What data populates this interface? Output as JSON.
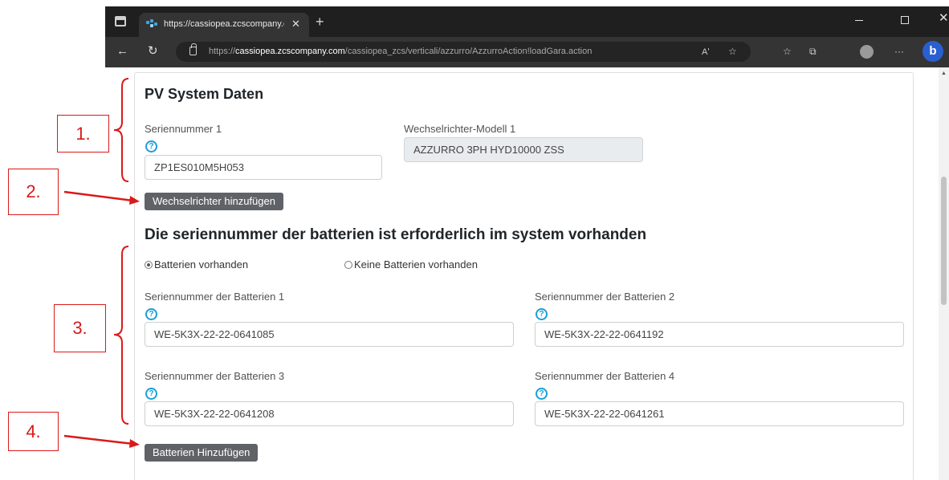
{
  "browser": {
    "tab_title": "https://cassiopea.zcscompany.co",
    "url_prefix": "https://",
    "url_domain": "cassiopea.zcscompany.com",
    "url_path": "/cassiopea_zcs/verticali/azzurro/AzzurroAction!loadGara.action",
    "read_aloud": "Aʹ",
    "more": "···",
    "bing_label": "b"
  },
  "pv": {
    "title": "PV System Daten",
    "serial_label": "Seriennummer 1",
    "serial_value": "ZP1ES010M5H053",
    "model_label": "Wechselrichter-Modell 1",
    "model_value": "AZZURRO 3PH HYD10000 ZSS",
    "add_inverter_label": "Wechselrichter hinzufügen"
  },
  "battery": {
    "title": "Die seriennummer der batterien ist erforderlich im system vorhanden",
    "radio_present": "Batterien vorhanden",
    "radio_absent": "Keine Batterien vorhanden",
    "fields": [
      {
        "label": "Seriennummer der Batterien 1",
        "value": "WE-5K3X-22-22-0641085"
      },
      {
        "label": "Seriennummer der Batterien 2",
        "value": "WE-5K3X-22-22-0641192"
      },
      {
        "label": "Seriennummer der Batterien 3",
        "value": "WE-5K3X-22-22-0641208"
      },
      {
        "label": "Seriennummer der Batterien 4",
        "value": "WE-5K3X-22-22-0641261"
      }
    ],
    "add_battery_label": "Batterien Hinzufügen"
  },
  "annotations": [
    "1.",
    "2.",
    "3.",
    "4."
  ],
  "colors": {
    "annotation": "#d91a1a",
    "help_icon": "#1a9fd8",
    "button": "#5f6368",
    "tabbar": "#1f1f1f"
  }
}
